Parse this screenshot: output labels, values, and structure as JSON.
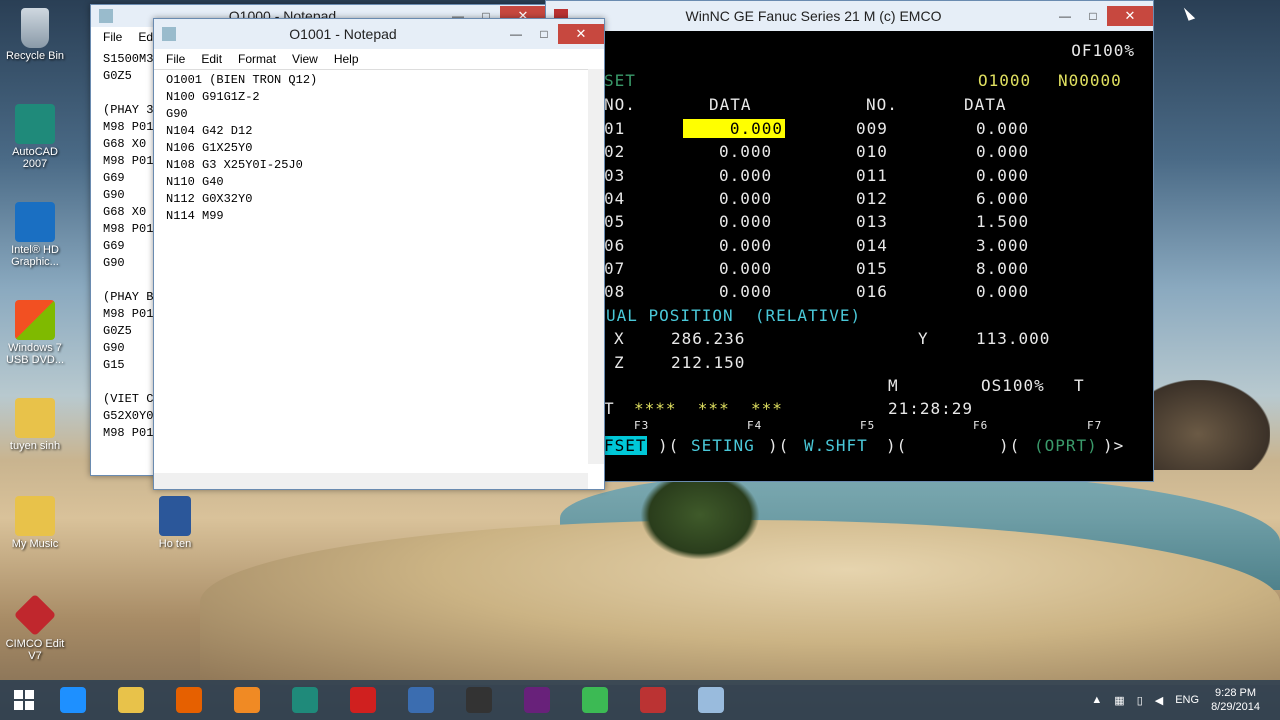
{
  "desktop": {
    "icons": [
      {
        "label": "Recycle Bin",
        "icon": "recycle-bin-icon"
      },
      {
        "label": "AutoCAD 2007",
        "icon": "autocad-icon"
      },
      {
        "label": "Intel® HD Graphic...",
        "icon": "intel-graphics-icon"
      },
      {
        "label": "Windows 7 USB DVD...",
        "icon": "windows-usb-icon"
      },
      {
        "label": "tuyen sinh",
        "icon": "folder-icon"
      },
      {
        "label": "My Music",
        "icon": "folder-icon"
      },
      {
        "label": "Ho ten",
        "icon": "word-document-icon"
      },
      {
        "label": "CIMCO Edit V7",
        "icon": "cimco-icon"
      }
    ]
  },
  "back_notepad": {
    "title": "O1000 - Notepad",
    "menu": [
      "File",
      "Edit"
    ],
    "lines": [
      "S1500M3",
      "G0Z5",
      "",
      "(PHAY 3",
      "M98 P01",
      "G68 X0",
      "M98 P01",
      "G69",
      "G90",
      "G68 X0",
      "M98 P01",
      "G69",
      "G90",
      "",
      "(PHAY B",
      "M98 P01",
      "G0Z5",
      "G90",
      "G15",
      "",
      "(VIET C",
      "G52X0Y0",
      "M98 P01"
    ]
  },
  "front_notepad": {
    "title": "O1001 - Notepad",
    "menu": [
      "File",
      "Edit",
      "Format",
      "View",
      "Help"
    ],
    "lines": [
      "O1001 (BIEN TRON Q12)",
      "N100 G91G1Z-2",
      "G90",
      "N104 G42 D12",
      "N106 G1X25Y0",
      "N108 G3 X25Y0I-25J0",
      "N110 G40",
      "N112 G0X32Y0",
      "N114 M99"
    ]
  },
  "cnc": {
    "title": "WinNC GE Fanuc Series 21 M (c) EMCO",
    "override": "OF100%",
    "screen_left": "SET",
    "program": "O1000",
    "sequence": "N00000",
    "col_no": "NO.",
    "col_data": "DATA",
    "rows_left": [
      [
        "001",
        "0.000"
      ],
      [
        "002",
        "0.000"
      ],
      [
        "003",
        "0.000"
      ],
      [
        "004",
        "0.000"
      ],
      [
        "005",
        "0.000"
      ],
      [
        "006",
        "0.000"
      ],
      [
        "007",
        "0.000"
      ],
      [
        "008",
        "0.000"
      ]
    ],
    "rows_right": [
      [
        "009",
        "0.000"
      ],
      [
        "010",
        "0.000"
      ],
      [
        "011",
        "0.000"
      ],
      [
        "012",
        "6.000"
      ],
      [
        "013",
        "1.500"
      ],
      [
        "014",
        "3.000"
      ],
      [
        "015",
        "8.000"
      ],
      [
        "016",
        "0.000"
      ]
    ],
    "pos_label": "UAL POSITION  (RELATIVE)",
    "x_label": "X",
    "x_value": "286.236",
    "y_label": "Y",
    "y_value": "113.000",
    "z_label": "Z",
    "z_value": "212.150",
    "mode": "M",
    "spindle_override": "OS100%",
    "t_label": "T",
    "status_prefix": "T",
    "status_stars": "****  ***  ***",
    "clock": "21:28:29",
    "fkeys": [
      "F3",
      "F4",
      "F5",
      "F6",
      "F7"
    ],
    "softkeys": [
      "FSET",
      ")(",
      "SETING",
      ")(",
      "W.SHFT",
      ")(",
      ")(",
      "(OPRT)",
      ")>"
    ]
  },
  "taskbar": {
    "apps": [
      "ie-icon",
      "file-explorer-icon",
      "firefox-icon",
      "media-player-icon",
      "autocad-icon",
      "solidworks-icon",
      "winnc-app-icon",
      "video-icon",
      "visual-studio-icon",
      "chrome-icon",
      "fanuc-icon",
      "notepad-icon"
    ],
    "lang": "ENG",
    "time": "9:28 PM",
    "date": "8/29/2014"
  }
}
